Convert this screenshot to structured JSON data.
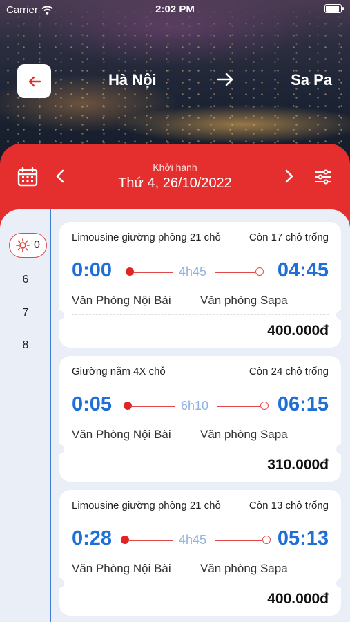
{
  "status_bar": {
    "carrier": "Carrier",
    "time": "2:02 PM"
  },
  "route": {
    "from": "Hà Nội",
    "to": "Sa Pa"
  },
  "date_bar": {
    "label": "Khởi hành",
    "value": "Thứ 4, 26/10/2022"
  },
  "hours": [
    "0",
    "6",
    "7",
    "8"
  ],
  "trips": [
    {
      "type": "Limousine giường phòng 21 chỗ",
      "seats": "Còn 17 chỗ trống",
      "depart": "0:00",
      "duration": "4h45",
      "arrive": "04:45",
      "from": "Văn Phòng Nội Bài",
      "to": "Văn phòng Sapa",
      "price": "400.000đ"
    },
    {
      "type": "Giường nằm 4X chỗ",
      "seats": "Còn 24 chỗ trống",
      "depart": "0:05",
      "duration": "6h10",
      "arrive": "06:15",
      "from": "Văn Phòng Nội Bài",
      "to": "Văn phòng Sapa",
      "price": "310.000đ"
    },
    {
      "type": "Limousine giường phòng 21 chỗ",
      "seats": "Còn 13 chỗ trống",
      "depart": "0:28",
      "duration": "4h45",
      "arrive": "05:13",
      "from": "Văn Phòng Nội Bài",
      "to": "Văn phòng Sapa",
      "price": "400.000đ"
    }
  ],
  "colors": {
    "brand_red": "#e52f2f",
    "time_blue": "#1f6fd6",
    "duration_blue": "#8fb3e3",
    "background": "#e9eef7"
  }
}
